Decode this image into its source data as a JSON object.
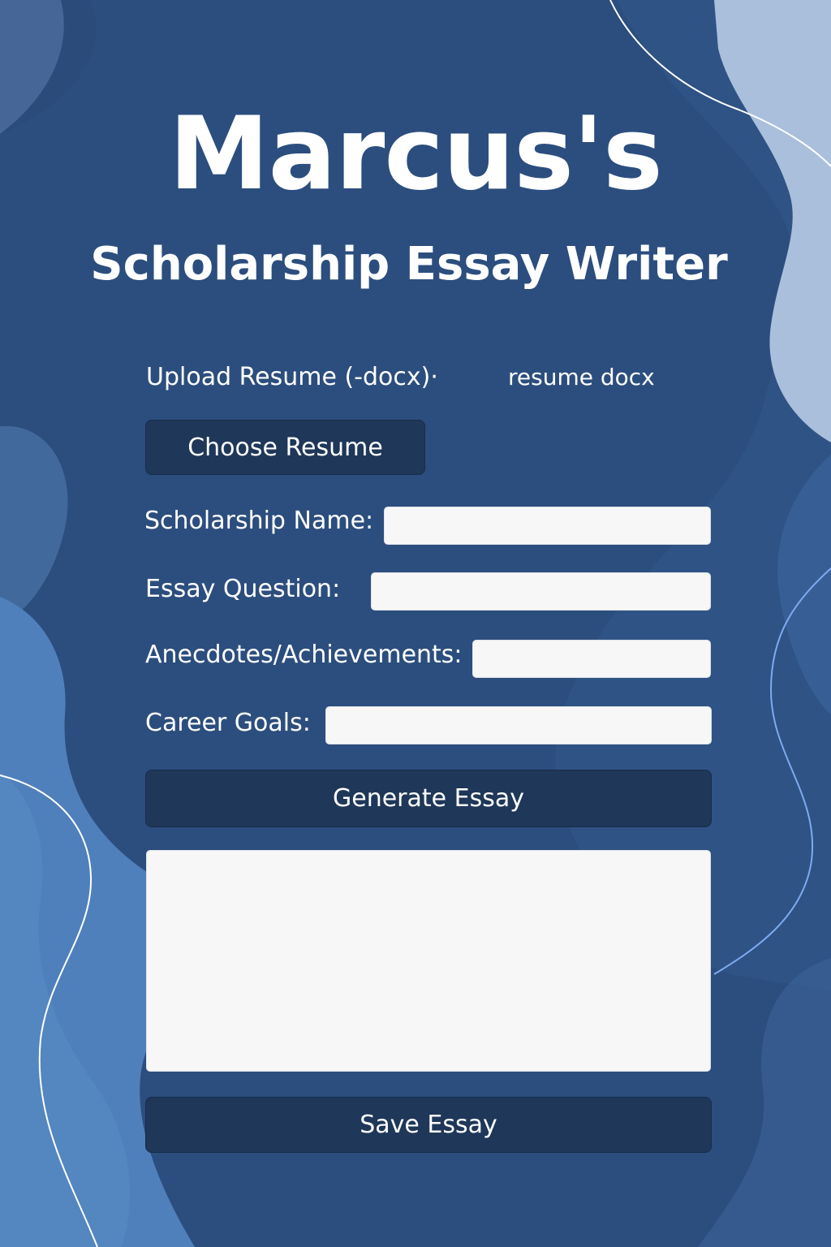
{
  "header": {
    "title": "Marcus's",
    "subtitle": "Scholarship Essay Writer"
  },
  "upload": {
    "label": "Upload Resume (-docx)·",
    "selected_file": "resume docx",
    "choose_button_label": "Choose Resume"
  },
  "form": {
    "scholarship_name": {
      "label": "Scholarship Name:",
      "value": ""
    },
    "essay_question": {
      "label": "Essay Question:",
      "value": ""
    },
    "anecdotes": {
      "label": "Anecdotes/Achievements:",
      "value": ""
    },
    "career_goals": {
      "label": "Career Goals:",
      "value": ""
    }
  },
  "actions": {
    "generate_label": "Generate Essay",
    "save_label": "Save Essay"
  },
  "output": {
    "essay_text": ""
  },
  "colors": {
    "background": "#2f5385",
    "button": "#1f3759",
    "field": "#f7f7f8",
    "text": "#ffffff"
  }
}
